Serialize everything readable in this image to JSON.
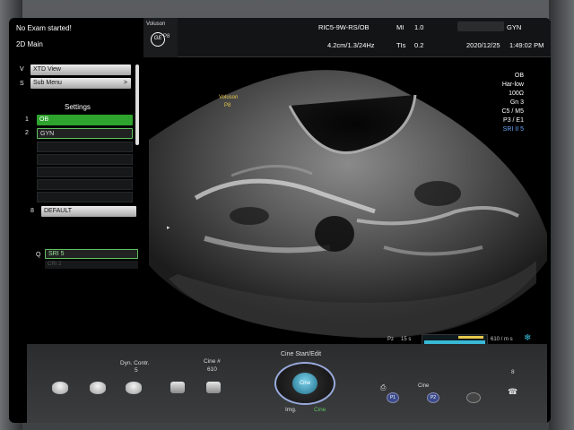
{
  "header": {
    "exam_status": "No Exam started!",
    "mode": "2D Main",
    "brand": "Voluson",
    "probe": "P8",
    "probe_settings": "RIC5-9W-RS/OB",
    "depth_info": "4.2cm/1.3/24Hz",
    "mi_label": "MI",
    "mi_value": "1.0",
    "tis_label": "TIs",
    "tis_value": "0.2",
    "date": "2020/12/25",
    "time": "1:49:02 PM",
    "app_suffix": "GYN"
  },
  "left_menu": {
    "v_key": "V",
    "xtd_view": "XTD View",
    "s_key": "S",
    "sub_menu": "Sub Menu",
    "settings_title": "Settings",
    "presets": [
      {
        "num": "1",
        "label": "OB"
      },
      {
        "num": "2",
        "label": "GYN"
      }
    ],
    "default_num": "8",
    "default_label": "DEFAULT",
    "q_key": "Q",
    "sri_label": "SRI 5",
    "sri_sub": "CRI 2"
  },
  "right_params": {
    "app": "OB",
    "harmonics": "Har-low",
    "dynamic": "100Ω",
    "gain": "Gn  3",
    "c_m": "C5 / M5",
    "p_e": "P3 / E1",
    "sri": "SRI II 5"
  },
  "image": {
    "brand": "Voluson",
    "probe": "P8"
  },
  "cine_bar": {
    "label": "Pz",
    "duration": "15 s",
    "frame_info": "610 / m s"
  },
  "bottom": {
    "dyn_contr_label": "Dyn. Contr.",
    "dyn_contr_value": "5",
    "cine_num_label": "Cine #",
    "cine_num_value": "610",
    "cine_start_label": "Cine Start/Edit",
    "img_label": "Img.",
    "cine_label": "Cine",
    "cine_center": "Cine",
    "p1": "P1",
    "p2": "P2",
    "cine_small": "Cine",
    "count": "8"
  },
  "colors": {
    "green": "#2ea32e",
    "cyan_bar": "#39b9d6",
    "sri_blue": "#6aa8ff",
    "yellow": "#e6c84a"
  }
}
